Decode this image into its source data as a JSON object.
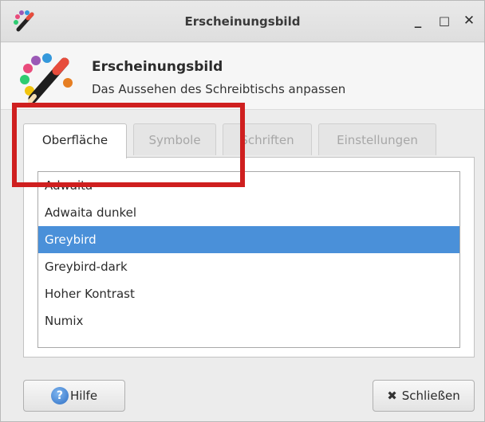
{
  "window": {
    "title": "Erscheinungsbild",
    "controls": {
      "minimize": "_",
      "maximize": "□",
      "close": "✕"
    }
  },
  "header": {
    "title": "Erscheinungsbild",
    "subtitle": "Das Aussehen des Schreibtischs anpassen",
    "icon": "appearance-palette-icon"
  },
  "tabs": [
    {
      "label": "Oberfläche",
      "active": true
    },
    {
      "label": "Symbole",
      "active": false
    },
    {
      "label": "Schriften",
      "active": false
    },
    {
      "label": "Einstellungen",
      "active": false
    }
  ],
  "themes": {
    "items": [
      "Adwaita",
      "Adwaita dunkel",
      "Greybird",
      "Greybird-dark",
      "Hoher Kontrast",
      "Numix"
    ],
    "selected": "Greybird",
    "selected_color": "#4a90d9"
  },
  "annotation": {
    "color": "#cf1f1f"
  },
  "footer": {
    "help_label": "Hilfe",
    "help_icon": "help-icon",
    "close_label": "Schließen",
    "close_icon": "close-icon"
  }
}
